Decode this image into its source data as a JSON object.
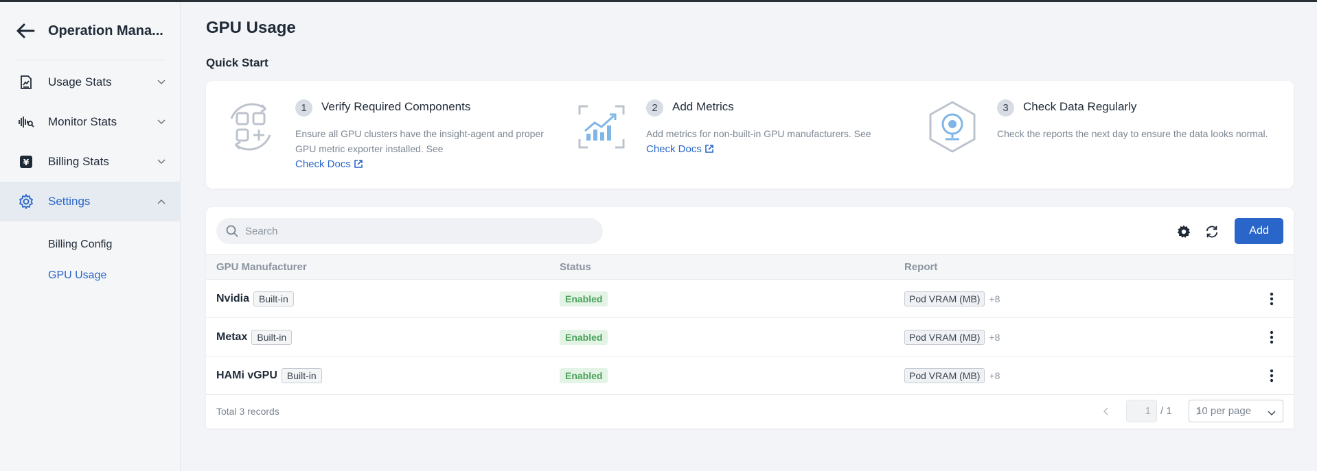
{
  "sidebar": {
    "title": "Operation Mana...",
    "items": [
      {
        "label": "Usage Stats",
        "icon": "usage-stats-icon"
      },
      {
        "label": "Monitor Stats",
        "icon": "monitor-stats-icon"
      },
      {
        "label": "Billing Stats",
        "icon": "billing-stats-icon"
      },
      {
        "label": "Settings",
        "icon": "gear-icon",
        "active": true
      }
    ],
    "sub_items": [
      {
        "label": "Billing Config"
      },
      {
        "label": "GPU Usage",
        "active": true
      }
    ]
  },
  "page": {
    "title": "GPU Usage",
    "quick_start_title": "Quick Start"
  },
  "quick_start": {
    "steps": [
      {
        "num": "1",
        "title": "Verify Required Components",
        "desc": "Ensure all GPU clusters have the insight-agent and proper GPU metric exporter installed. See",
        "link": "Check Docs"
      },
      {
        "num": "2",
        "title": "Add Metrics",
        "desc": "Add metrics for non-built-in GPU manufacturers. See",
        "link": "Check Docs"
      },
      {
        "num": "3",
        "title": "Check Data Regularly",
        "desc": "Check the reports the next day to ensure the data looks normal."
      }
    ]
  },
  "toolbar": {
    "search_placeholder": "Search",
    "add_label": "Add"
  },
  "table": {
    "columns": [
      "GPU Manufacturer",
      "Status",
      "Report"
    ],
    "rows": [
      {
        "name": "Nvidia",
        "tag": "Built-in",
        "status": "Enabled",
        "report": "Pod VRAM (MB)",
        "more": "+8"
      },
      {
        "name": "Metax",
        "tag": "Built-in",
        "status": "Enabled",
        "report": "Pod VRAM (MB)",
        "more": "+8"
      },
      {
        "name": "HAMi vGPU",
        "tag": "Built-in",
        "status": "Enabled",
        "report": "Pod VRAM (MB)",
        "more": "+8"
      }
    ]
  },
  "pagination": {
    "total": "Total 3 records",
    "current_page": "1",
    "total_pages": "/ 1",
    "per_page": "10 per page"
  },
  "colors": {
    "accent": "#2a66c9",
    "status_bg": "#e3f4e6",
    "status_text": "#4ba15a"
  }
}
